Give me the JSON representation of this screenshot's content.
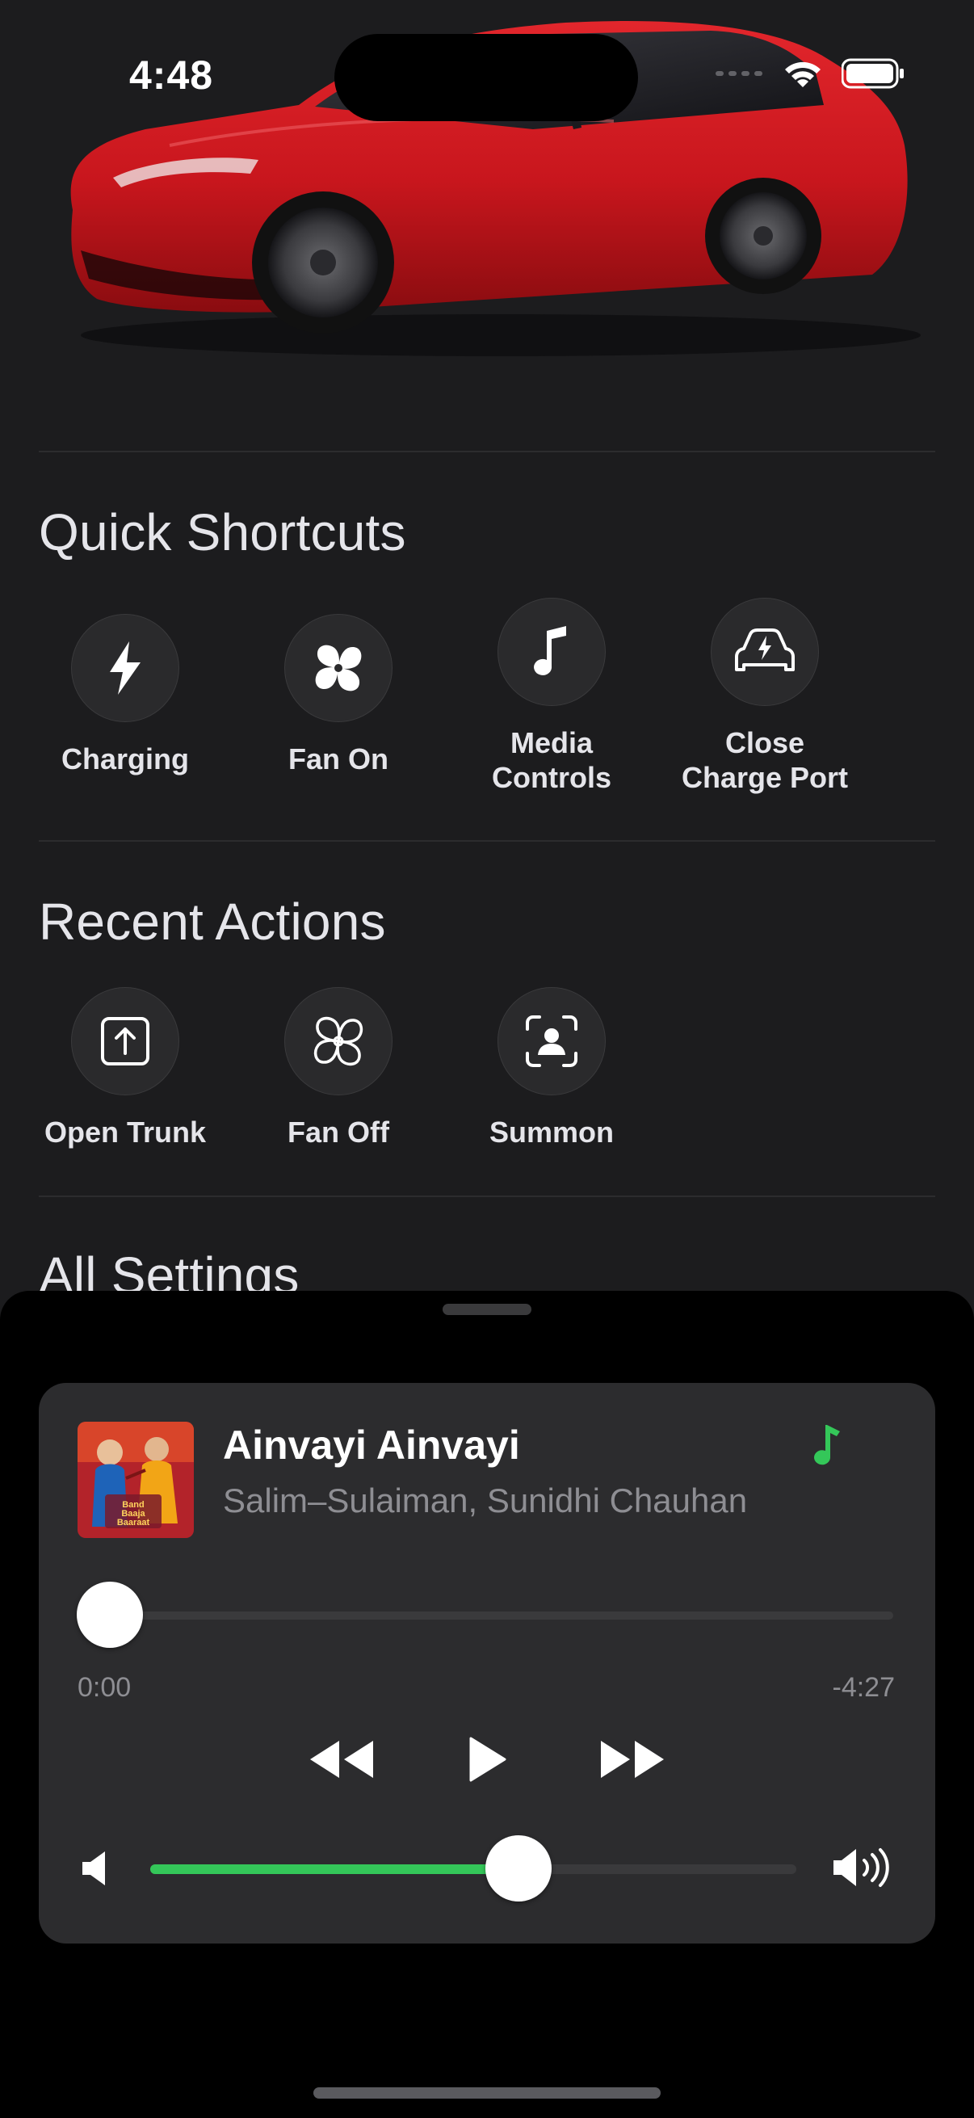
{
  "status_bar": {
    "time": "4:48",
    "wifi_icon": "wifi-icon",
    "battery_icon": "battery-icon"
  },
  "colors": {
    "background": "#1c1c1e",
    "accent_green": "#34c759",
    "car_red": "#c8161d"
  },
  "quick_shortcuts": {
    "title": "Quick Shortcuts",
    "items": [
      {
        "label": "Charging",
        "icon": "bolt-icon"
      },
      {
        "label": "Fan On",
        "icon": "fan-filled-icon"
      },
      {
        "label": "Media\nControls",
        "icon": "music-note-icon"
      },
      {
        "label": "Close\nCharge Port",
        "icon": "car-bolt-icon"
      }
    ]
  },
  "recent_actions": {
    "title": "Recent Actions",
    "items": [
      {
        "label": "Open Trunk",
        "icon": "share-up-icon"
      },
      {
        "label": "Fan Off",
        "icon": "fan-outline-icon"
      },
      {
        "label": "Summon",
        "icon": "person-frame-icon"
      }
    ]
  },
  "all_settings": {
    "title": "All Settings"
  },
  "now_playing": {
    "title": "Ainvayi Ainvayi",
    "artist": "Salim–Sulaiman, Sunidhi Chauhan",
    "album_art_text": "Band Baaja Baaraat",
    "elapsed": "0:00",
    "remaining": "-4:27",
    "progress_fraction": 0.0,
    "volume_fraction": 0.57
  }
}
